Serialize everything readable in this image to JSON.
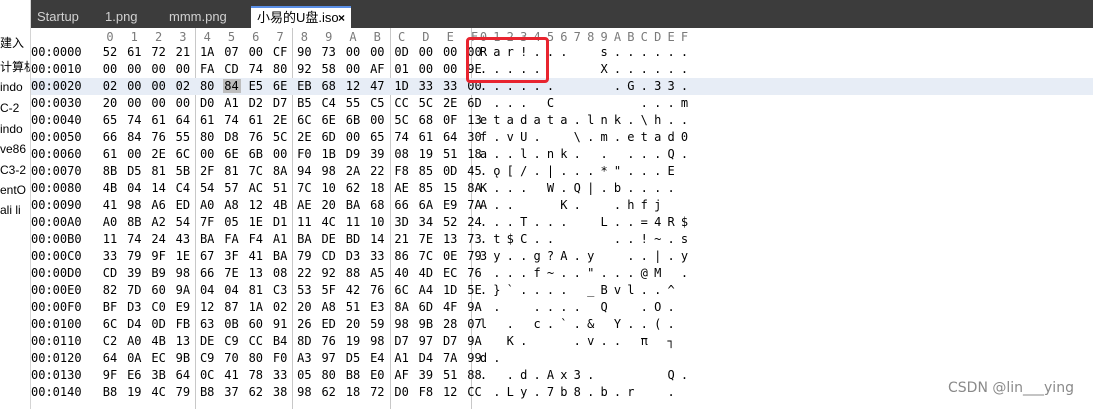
{
  "colors": {
    "tabbar": "#3c3c3c",
    "active_tab_accent": "#5a8fe6",
    "row_highlight": "#e7edf6",
    "selected_byte": "#bdbdbd",
    "annotation_box": "#e8242f"
  },
  "left_panel": {
    "items": [
      "建入",
      "计算机",
      "indo",
      "C-2",
      "indo",
      "ve86",
      "C3-2",
      "entO",
      "ali li"
    ]
  },
  "tabs": [
    {
      "label": "Startup",
      "active": false
    },
    {
      "label": "1.png",
      "active": false
    },
    {
      "label": "mmm.png",
      "active": false
    },
    {
      "label": "小易的U盘.iso",
      "active": true,
      "close": "×"
    }
  ],
  "hex_view": {
    "column_headers": [
      "0",
      "1",
      "2",
      "3",
      "4",
      "5",
      "6",
      "7",
      "8",
      "9",
      "A",
      "B",
      "C",
      "D",
      "E",
      "F"
    ],
    "ascii_headers": [
      "0",
      "1",
      "2",
      "3",
      "4",
      "5",
      "6",
      "7",
      "8",
      "9",
      "A",
      "B",
      "C",
      "D",
      "E",
      "F"
    ],
    "rows": [
      {
        "addr": "00:0000",
        "hex": [
          "52",
          "61",
          "72",
          "21",
          "1A",
          "07",
          "00",
          "CF",
          "90",
          "73",
          "00",
          "00",
          "0D",
          "00",
          "00",
          "00"
        ],
        "ascii": [
          "R",
          "a",
          "r",
          "!",
          ".",
          ".",
          ".",
          "",
          "",
          "s",
          ".",
          ".",
          ".",
          ".",
          ".",
          "."
        ]
      },
      {
        "addr": "00:0010",
        "hex": [
          "00",
          "00",
          "00",
          "00",
          "FA",
          "CD",
          "74",
          "80",
          "92",
          "58",
          "00",
          "AF",
          "01",
          "00",
          "00",
          "9E"
        ],
        "ascii": [
          ".",
          ".",
          ".",
          ".",
          ".",
          "",
          "",
          "",
          "",
          "X",
          ".",
          ".",
          ".",
          ".",
          ".",
          "."
        ]
      },
      {
        "addr": "00:0020",
        "hex": [
          "02",
          "00",
          "00",
          "02",
          "80",
          "84",
          "E5",
          "6E",
          "EB",
          "68",
          "12",
          "47",
          "1D",
          "33",
          "33",
          "00"
        ],
        "ascii": [
          ".",
          ".",
          ".",
          ".",
          ".",
          ".",
          "",
          "",
          "",
          "",
          ".",
          "G",
          ".",
          "3",
          "3",
          "."
        ]
      },
      {
        "addr": "00:0030",
        "hex": [
          "20",
          "00",
          "00",
          "00",
          "D0",
          "A1",
          "D2",
          "D7",
          "B5",
          "C4",
          "55",
          "C5",
          "CC",
          "5C",
          "2E",
          "6D"
        ],
        "ascii": [
          "",
          ".",
          ".",
          ".",
          "",
          "C",
          "",
          "",
          "",
          "",
          "",
          "",
          ".",
          ".",
          ".",
          "m"
        ]
      },
      {
        "addr": "00:0040",
        "hex": [
          "65",
          "74",
          "61",
          "64",
          "61",
          "74",
          "61",
          "2E",
          "6C",
          "6E",
          "6B",
          "00",
          "5C",
          "68",
          "0F",
          "13"
        ],
        "ascii": [
          "e",
          "t",
          "a",
          "d",
          "a",
          "t",
          "a",
          ".",
          "l",
          "n",
          "k",
          ".",
          "\\",
          "h",
          ".",
          "."
        ]
      },
      {
        "addr": "00:0050",
        "hex": [
          "66",
          "84",
          "76",
          "55",
          "80",
          "D8",
          "76",
          "5C",
          "2E",
          "6D",
          "00",
          "65",
          "74",
          "61",
          "64",
          "30"
        ],
        "ascii": [
          "f",
          ".",
          "v",
          "U",
          ".",
          "",
          "",
          "\\",
          ".",
          "m",
          ".",
          "e",
          "t",
          "a",
          "d",
          "0"
        ]
      },
      {
        "addr": "00:0060",
        "hex": [
          "61",
          "00",
          "2E",
          "6C",
          "00",
          "6E",
          "6B",
          "00",
          "F0",
          "1B",
          "D9",
          "39",
          "08",
          "19",
          "51",
          "18"
        ],
        "ascii": [
          "a",
          ".",
          ".",
          "l",
          ".",
          "n",
          "k",
          ".",
          "",
          ".",
          "",
          ".",
          ".",
          ".",
          "Q",
          "."
        ]
      },
      {
        "addr": "00:0070",
        "hex": [
          "8B",
          "D5",
          "81",
          "5B",
          "2F",
          "81",
          "7C",
          "8A",
          "94",
          "98",
          "2A",
          "22",
          "F8",
          "85",
          "0D",
          "45"
        ],
        "ascii": [
          ".",
          "ǫ",
          "[",
          "/",
          ".",
          "|",
          ".",
          ".",
          ".",
          "*",
          "\"",
          ".",
          ".",
          ".",
          "E",
          ""
        ]
      },
      {
        "addr": "00:0080",
        "hex": [
          "4B",
          "04",
          "14",
          "C4",
          "54",
          "57",
          "AC",
          "51",
          "7C",
          "10",
          "62",
          "18",
          "AE",
          "85",
          "15",
          "8A"
        ],
        "ascii": [
          "K",
          ".",
          ".",
          ".",
          "",
          "W",
          ".",
          "Q",
          "|",
          ".",
          "b",
          ".",
          ".",
          ".",
          ".",
          ""
        ]
      },
      {
        "addr": "00:0090",
        "hex": [
          "41",
          "98",
          "A6",
          "ED",
          "A0",
          "A8",
          "12",
          "4B",
          "AE",
          "20",
          "BA",
          "68",
          "66",
          "6A",
          "E9",
          "7A"
        ],
        "ascii": [
          "A",
          ".",
          ".",
          "",
          "",
          "",
          "K",
          ".",
          "",
          "",
          ".",
          "h",
          "f",
          "j",
          "",
          ""
        ]
      },
      {
        "addr": "00:00A0",
        "hex": [
          "A0",
          "8B",
          "A2",
          "54",
          "7F",
          "05",
          "1E",
          "D1",
          "11",
          "4C",
          "11",
          "10",
          "3D",
          "34",
          "52",
          "24"
        ],
        "ascii": [
          ".",
          ".",
          ".",
          "T",
          ".",
          ".",
          ".",
          "",
          "",
          "L",
          ".",
          ".",
          "=",
          "4",
          "R",
          "$"
        ]
      },
      {
        "addr": "00:00B0",
        "hex": [
          "11",
          "74",
          "24",
          "43",
          "BA",
          "FA",
          "F4",
          "A1",
          "BA",
          "DE",
          "BD",
          "14",
          "21",
          "7E",
          "13",
          "73"
        ],
        "ascii": [
          ".",
          "t",
          "$",
          "C",
          ".",
          ".",
          "",
          "",
          "",
          "",
          ".",
          ".",
          "!",
          "~",
          ".",
          "s"
        ]
      },
      {
        "addr": "00:00C0",
        "hex": [
          "33",
          "79",
          "9F",
          "1E",
          "67",
          "3F",
          "41",
          "BA",
          "79",
          "CD",
          "D3",
          "33",
          "86",
          "7C",
          "0E",
          "79"
        ],
        "ascii": [
          "3",
          "y",
          ".",
          ".",
          "g",
          "?",
          "A",
          ".",
          "y",
          "",
          "",
          ".",
          ".",
          "|",
          ".",
          "y"
        ]
      },
      {
        "addr": "00:00D0",
        "hex": [
          "CD",
          "39",
          "B9",
          "98",
          "66",
          "7E",
          "13",
          "08",
          "22",
          "92",
          "88",
          "A5",
          "40",
          "4D",
          "EC",
          "76"
        ],
        "ascii": [
          "",
          ".",
          ".",
          ".",
          "f",
          "~",
          ".",
          ".",
          "\"",
          ".",
          ".",
          ".",
          "@",
          "M",
          "",
          "."
        ]
      },
      {
        "addr": "00:00E0",
        "hex": [
          "82",
          "7D",
          "60",
          "9A",
          "04",
          "04",
          "81",
          "C3",
          "53",
          "5F",
          "42",
          "76",
          "6C",
          "A4",
          "1D",
          "5E"
        ],
        "ascii": [
          ".",
          "}",
          "`",
          ".",
          ".",
          ".",
          ".",
          "",
          "_",
          "B",
          "v",
          "l",
          ".",
          ".",
          "^",
          ""
        ]
      },
      {
        "addr": "00:00F0",
        "hex": [
          "BF",
          "D3",
          "C0",
          "E9",
          "12",
          "87",
          "1A",
          "02",
          "20",
          "A8",
          "51",
          "E3",
          "8A",
          "6D",
          "4F",
          "9A"
        ],
        "ascii": [
          "",
          ".",
          "",
          "",
          ".",
          ".",
          ".",
          ".",
          "",
          "Q",
          "",
          "",
          ".",
          "O",
          ".",
          ""
        ]
      },
      {
        "addr": "00:0100",
        "hex": [
          "6C",
          "D4",
          "0D",
          "FB",
          "63",
          "0B",
          "60",
          "91",
          "26",
          "ED",
          "20",
          "59",
          "98",
          "9B",
          "28",
          "07"
        ],
        "ascii": [
          "l",
          "",
          ".",
          "",
          "c",
          ".",
          "`",
          ".",
          "&",
          "",
          "Y",
          ".",
          ".",
          "(",
          ".",
          ""
        ]
      },
      {
        "addr": "00:0110",
        "hex": [
          "C2",
          "A0",
          "4B",
          "13",
          "DE",
          "C9",
          "CC",
          "B4",
          "8D",
          "76",
          "19",
          "98",
          "D7",
          "97",
          "D7",
          "9A"
        ],
        "ascii": [
          "",
          "",
          "K",
          ".",
          "",
          "",
          "",
          ".",
          "v",
          ".",
          ".",
          "",
          "π",
          "",
          "┐",
          ""
        ]
      },
      {
        "addr": "00:0120",
        "hex": [
          "64",
          "0A",
          "EC",
          "9B",
          "C9",
          "70",
          "80",
          "F0",
          "A3",
          "97",
          "D5",
          "E4",
          "A1",
          "D4",
          "7A",
          "99"
        ],
        "ascii": [
          "d",
          ".",
          "",
          "",
          "",
          "",
          "",
          "",
          "",
          "",
          "",
          "",
          "",
          "",
          "",
          ""
        ]
      },
      {
        "addr": "00:0130",
        "hex": [
          "9F",
          "E6",
          "3B",
          "64",
          "0C",
          "41",
          "78",
          "33",
          "05",
          "80",
          "B8",
          "E0",
          "AF",
          "39",
          "51",
          "88"
        ],
        "ascii": [
          ".",
          "",
          ".",
          "d",
          ".",
          "A",
          "x",
          "3",
          ".",
          "",
          "",
          "",
          "",
          "",
          "Q",
          "."
        ]
      },
      {
        "addr": "00:0140",
        "hex": [
          "B8",
          "19",
          "4C",
          "79",
          "B8",
          "37",
          "62",
          "38",
          "98",
          "62",
          "18",
          "72",
          "D0",
          "F8",
          "12",
          "CC"
        ],
        "ascii": [
          "",
          ".",
          "L",
          "y",
          ".",
          "7",
          "b",
          "8",
          ".",
          "b",
          ".",
          "r",
          "",
          "",
          ".",
          ""
        ]
      }
    ]
  },
  "annotation": {
    "label": ""
  },
  "watermark": "CSDN @lin___ying"
}
